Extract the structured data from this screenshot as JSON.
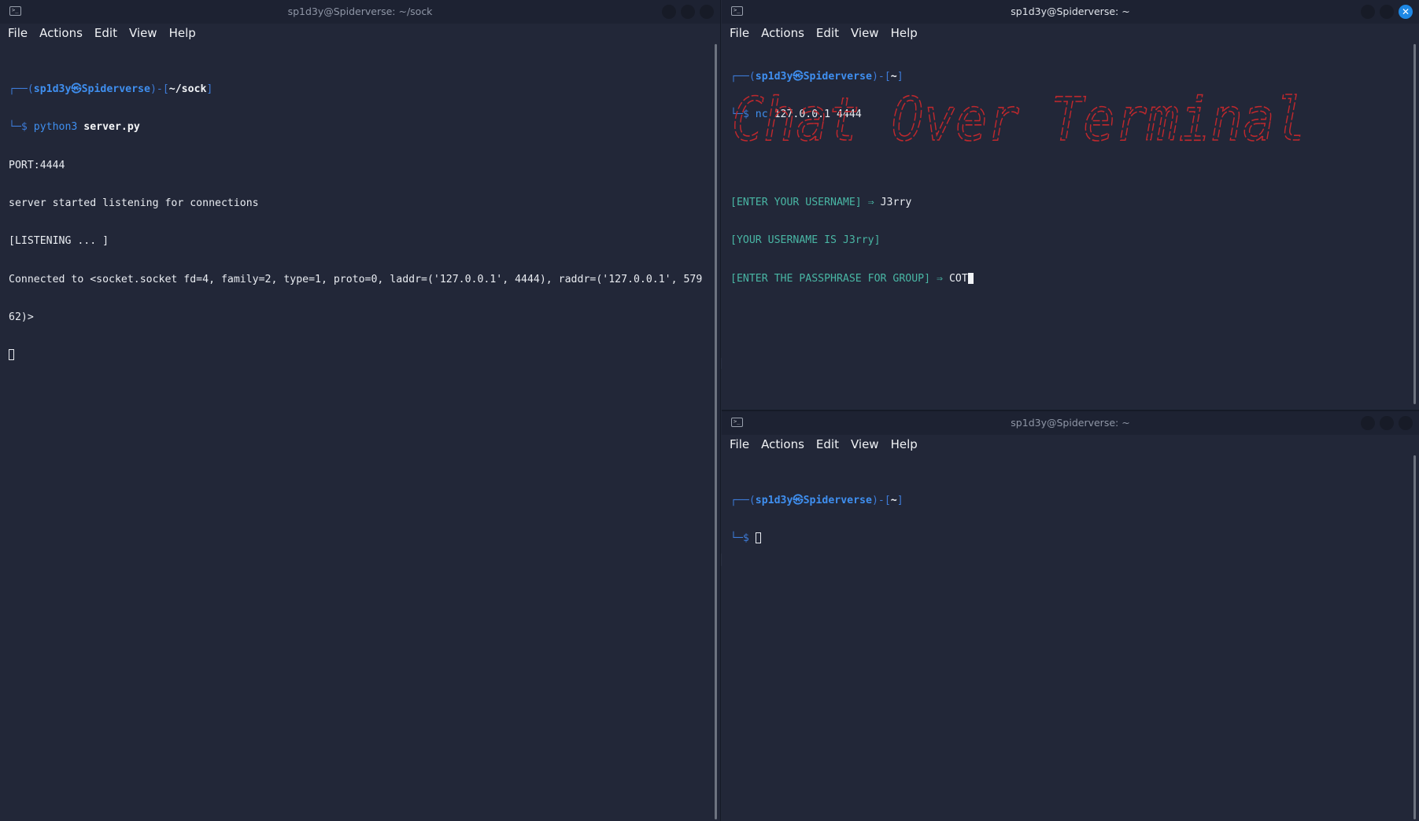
{
  "left_window": {
    "title": "sp1d3y@Spiderverse: ~/sock",
    "menu": [
      "File",
      "Actions",
      "Edit",
      "View",
      "Help"
    ],
    "prompt": {
      "user": "sp1d3y",
      "at": "㉿",
      "host": "Spiderverse",
      "path": "~/sock"
    },
    "command": {
      "program": "python3",
      "arg": "server.py"
    },
    "output": [
      "PORT:4444",
      "server started listening for connections",
      "[LISTENING ... ]",
      "Connected to <socket.socket fd=4, family=2, type=1, proto=0, laddr=('127.0.0.1', 4444), raddr=('127.0.0.1', 579",
      "62)>"
    ]
  },
  "top_right_window": {
    "title": "sp1d3y@Spiderverse: ~",
    "menu": [
      "File",
      "Actions",
      "Edit",
      "View",
      "Help"
    ],
    "prompt": {
      "user": "sp1d3y",
      "at": "㉿",
      "host": "Spiderverse",
      "path": "~"
    },
    "command": {
      "program": "nc",
      "arg": "127.0.0.1 4444"
    },
    "banner_text": "Chat Over Terminal",
    "prompts": [
      {
        "label": "[ENTER YOUR USERNAME]",
        "arrow": "⇒",
        "value": "J3rry"
      },
      {
        "label": "[YOUR USERNAME IS J3rry]"
      },
      {
        "label": "[ENTER THE PASSPHRASE FOR GROUP]",
        "arrow": "⇒",
        "value": "COT"
      }
    ]
  },
  "bottom_right_window": {
    "title": "sp1d3y@Spiderverse: ~",
    "menu": [
      "File",
      "Actions",
      "Edit",
      "View",
      "Help"
    ],
    "prompt": {
      "user": "sp1d3y",
      "at": "㉿",
      "host": "Spiderverse",
      "path": "~"
    }
  },
  "colors": {
    "background": "#222738",
    "prompt_blue": "#3f8ff0",
    "banner_red": "#c0282d",
    "app_green": "#49b6a4",
    "close_button": "#1e88e5"
  }
}
